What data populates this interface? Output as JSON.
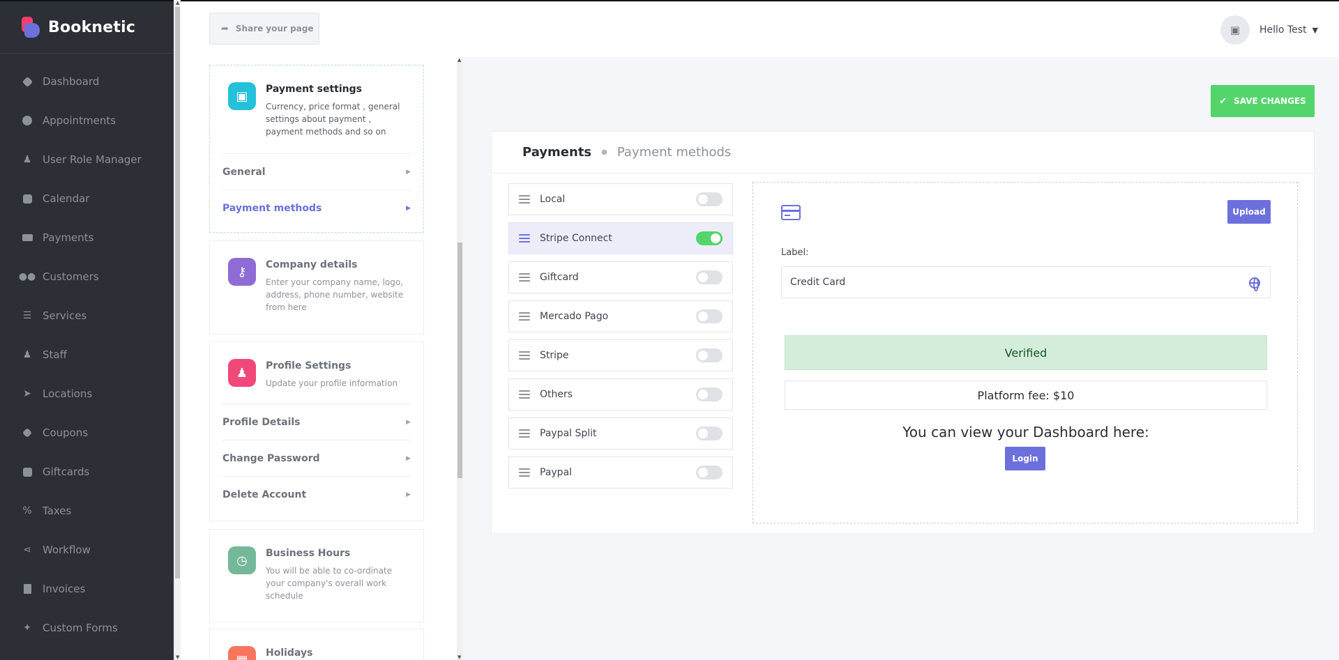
{
  "brand": {
    "name": "Booknetic"
  },
  "sidebar": {
    "items": [
      {
        "label": "Dashboard",
        "icon": "dashboard-icon"
      },
      {
        "label": "Appointments",
        "icon": "clock-icon"
      },
      {
        "label": "User Role Manager",
        "icon": "user-plus-icon"
      },
      {
        "label": "Calendar",
        "icon": "calendar-icon"
      },
      {
        "label": "Payments",
        "icon": "credit-card-icon"
      },
      {
        "label": "Customers",
        "icon": "users-icon"
      },
      {
        "label": "Services",
        "icon": "list-icon"
      },
      {
        "label": "Staff",
        "icon": "user-icon"
      },
      {
        "label": "Locations",
        "icon": "location-arrow-icon"
      },
      {
        "label": "Coupons",
        "icon": "tag-icon"
      },
      {
        "label": "Giftcards",
        "icon": "gift-icon"
      },
      {
        "label": "Taxes",
        "icon": "percent-icon"
      },
      {
        "label": "Workflow",
        "icon": "workflow-icon"
      },
      {
        "label": "Invoices",
        "icon": "file-icon"
      },
      {
        "label": "Custom Forms",
        "icon": "magic-wand-icon"
      }
    ]
  },
  "header": {
    "share_label": "Share your page",
    "user_name": "Hello Test"
  },
  "settings": {
    "payment": {
      "title": "Payment settings",
      "desc": "Currency, price format , general settings about payment , payment methods and so on",
      "links": [
        "General",
        "Payment methods"
      ]
    },
    "company": {
      "title": "Company details",
      "desc": "Enter your company name, logo, address, phone number, website from here"
    },
    "profile": {
      "title": "Profile Settings",
      "desc": "Update your profile information",
      "links": [
        "Profile Details",
        "Change Password",
        "Delete Account"
      ]
    },
    "hours": {
      "title": "Business Hours",
      "desc": "You will be able to co-ordinate your company's overall work schedule"
    },
    "holidays": {
      "title": "Holidays"
    }
  },
  "main": {
    "save_label": "SAVE CHANGES",
    "breadcrumb": [
      "Payments",
      "Payment methods"
    ],
    "methods": [
      {
        "name": "Local",
        "enabled": false
      },
      {
        "name": "Stripe Connect",
        "enabled": true
      },
      {
        "name": "Giftcard",
        "enabled": false
      },
      {
        "name": "Mercado Pago",
        "enabled": false
      },
      {
        "name": "Stripe",
        "enabled": false
      },
      {
        "name": "Others",
        "enabled": false
      },
      {
        "name": "Paypal Split",
        "enabled": false
      },
      {
        "name": "Paypal",
        "enabled": false
      }
    ],
    "detail": {
      "upload_label": "Upload",
      "label_title": "Label:",
      "label_value": "Credit Card",
      "verified_text": "Verified",
      "fee_text": "Platform fee: $10",
      "dashboard_text": "You can view your Dashboard here:",
      "login_label": "Login"
    }
  },
  "colors": {
    "accent": "#6c70dc",
    "success": "#53d56c",
    "sidebar_bg": "#2c2f36"
  }
}
